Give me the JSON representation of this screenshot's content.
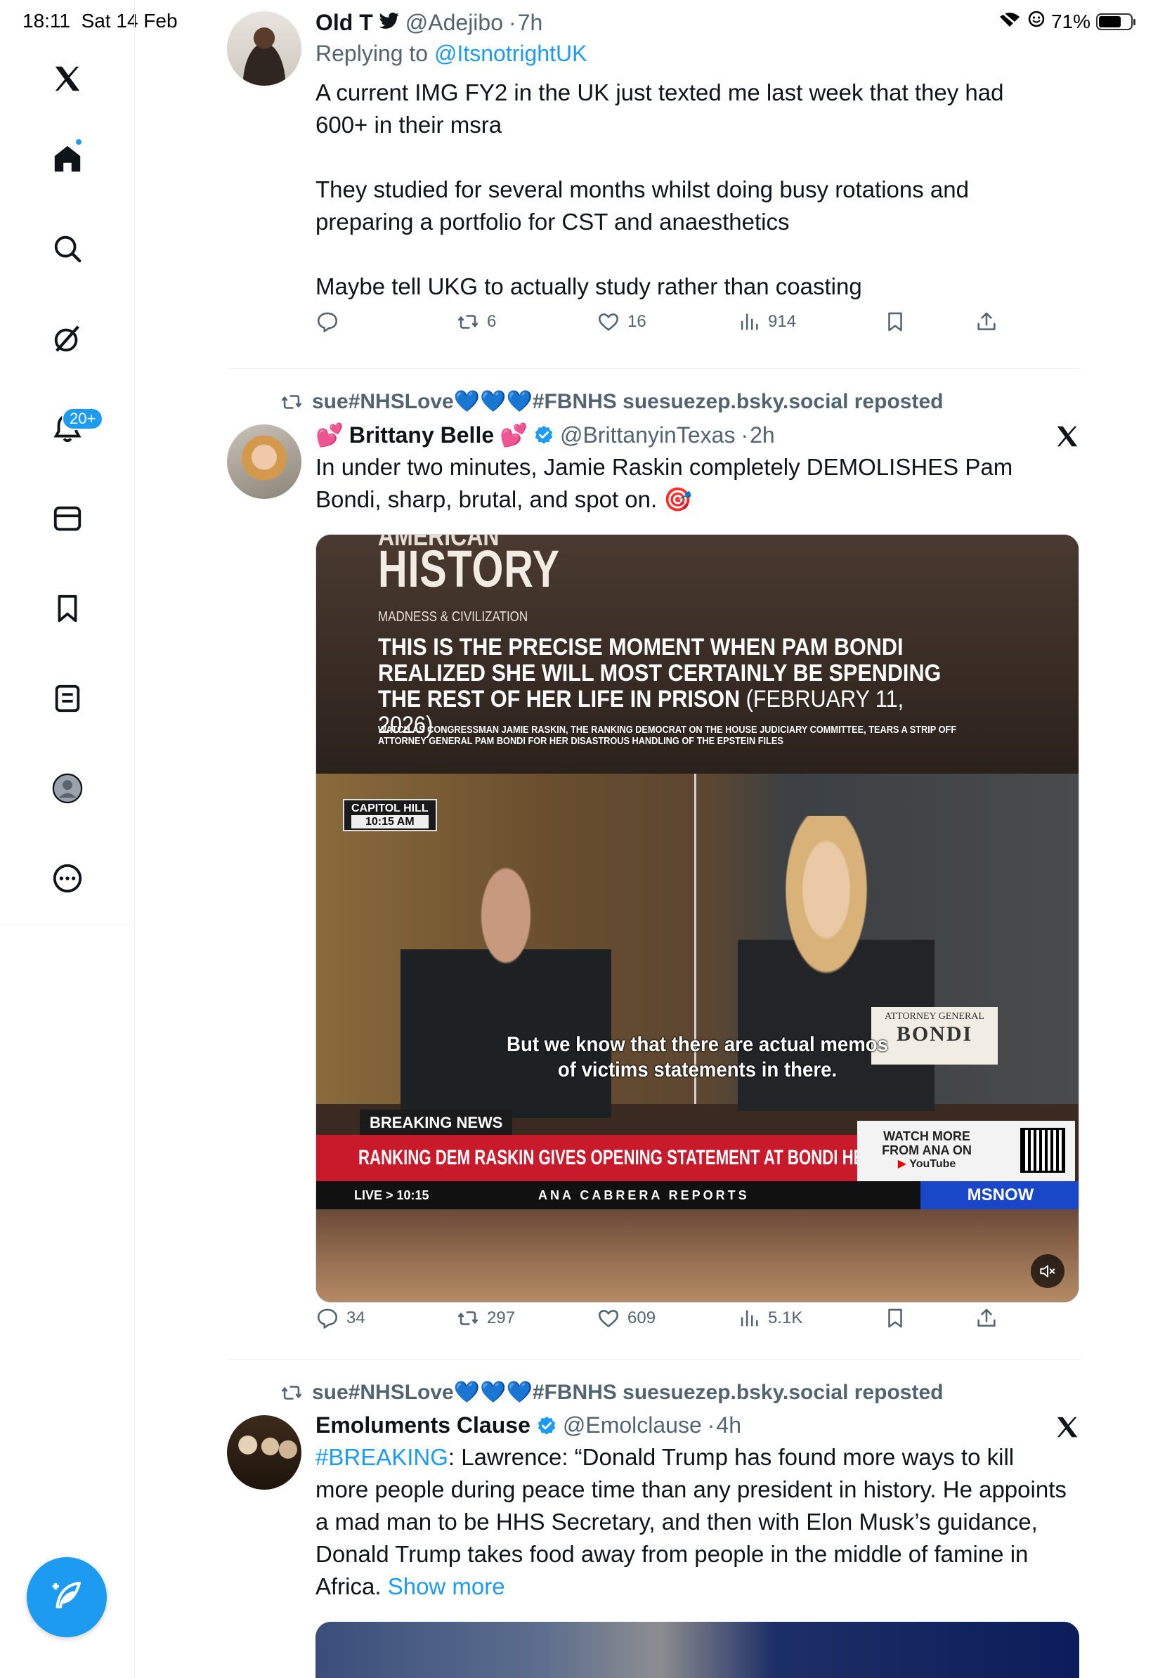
{
  "status_bar": {
    "time": "18:11",
    "date": "Sat 14 Feb",
    "battery": "71%",
    "battery_level": 0.71
  },
  "sidebar": {
    "items": [
      {
        "icon": "x-logo-icon"
      },
      {
        "icon": "home-icon",
        "has_dot": true
      },
      {
        "icon": "search-icon"
      },
      {
        "icon": "grok-icon"
      },
      {
        "icon": "notifications-icon",
        "badge": "20+"
      },
      {
        "icon": "messages-icon"
      },
      {
        "icon": "bookmarks-icon"
      },
      {
        "icon": "lists-icon"
      },
      {
        "icon": "profile-icon"
      },
      {
        "icon": "more-icon"
      }
    ],
    "compose": {
      "icon": "compose-icon"
    }
  },
  "colors": {
    "accent": "#1d9bf0",
    "text": "#0f1419",
    "muted": "#536471",
    "divider": "#eff3f4"
  },
  "tweets": [
    {
      "name": "Old T",
      "handle": "@Adejibo",
      "time": "7h",
      "replying_label": "Replying to",
      "replying_to": "@ItsnotrightUK",
      "text1": "A current IMG FY2 in the UK just texted me last week that they had 600+ in their msra",
      "text2": "They studied for several months whilst doing busy rotations and preparing a portfolio for CST and anaesthetics",
      "text3": "Maybe tell UKG to actually study rather than coasting",
      "reposts": "6",
      "likes": "16",
      "views": "914"
    },
    {
      "reposted_by": "sue#NHSLove💙💙💙#FBNHS suesuezep.bsky.social reposted",
      "name_prefix": "💕",
      "name": "Brittany Belle",
      "name_suffix": "💕",
      "handle": "@BrittanyinTexas",
      "time": "2h",
      "text": "In under two minutes, Jamie Raskin completely DEMOLISHES Pam Bondi, sharp, brutal, and spot on. 🎯",
      "replies": "34",
      "reposts": "297",
      "likes": "609",
      "views": "5.1K",
      "media": {
        "brand_top": "AMERICAN",
        "brand": "HISTORY",
        "brand_sub": "MADNESS & CIVILIZATION",
        "headline": "THIS IS THE PRECISE MOMENT WHEN PAM BONDI REALIZED SHE WILL MOST CERTAINLY BE SPENDING THE REST OF HER LIFE IN PRISON",
        "headline_date": "(FEBRUARY 11, 2026)",
        "small_text": "WATCH AS CONGRESSMAN JAMIE RASKIN, THE RANKING DEMOCRAT ON THE HOUSE JUDICIARY COMMITTEE, TEARS A STRIP OFF ATTORNEY GENERAL PAM BONDI FOR HER DISASTROUS HANDLING OF THE EPSTEIN FILES",
        "location_tag": "CAPITOL HILL",
        "location_time": "10:15 AM",
        "nameplate_title": "ATTORNEY GENERAL",
        "nameplate_name": "BONDI",
        "subtitle_line1": "But we know that there are actual memos",
        "subtitle_line2": "of victims statements in there.",
        "breaking_label": "BREAKING NEWS",
        "ticker": "RANKING DEM RASKIN GIVES OPENING STATEMENT AT BONDI HEARING",
        "watch_more": "WATCH MORE FROM ANA ON",
        "youtube": "YouTube",
        "live_label": "LIVE > 10:15",
        "show_name": "ANA CABRERA REPORTS",
        "network": "MSNOW"
      }
    },
    {
      "reposted_by": "sue#NHSLove💙💙💙#FBNHS suesuezep.bsky.social reposted",
      "name": "Emoluments Clause",
      "handle": "@Emolclause",
      "time": "4h",
      "hashtag": "#BREAKING",
      "text": ": Lawrence: “Donald Trump has found more ways to kill more people during peace time than any president in history. He appoints a mad man to be HHS Secretary, and then with Elon Musk’s guidance, Donald Trump takes food away from people in the middle of famine in Africa.",
      "show_more": "Show more"
    }
  ]
}
